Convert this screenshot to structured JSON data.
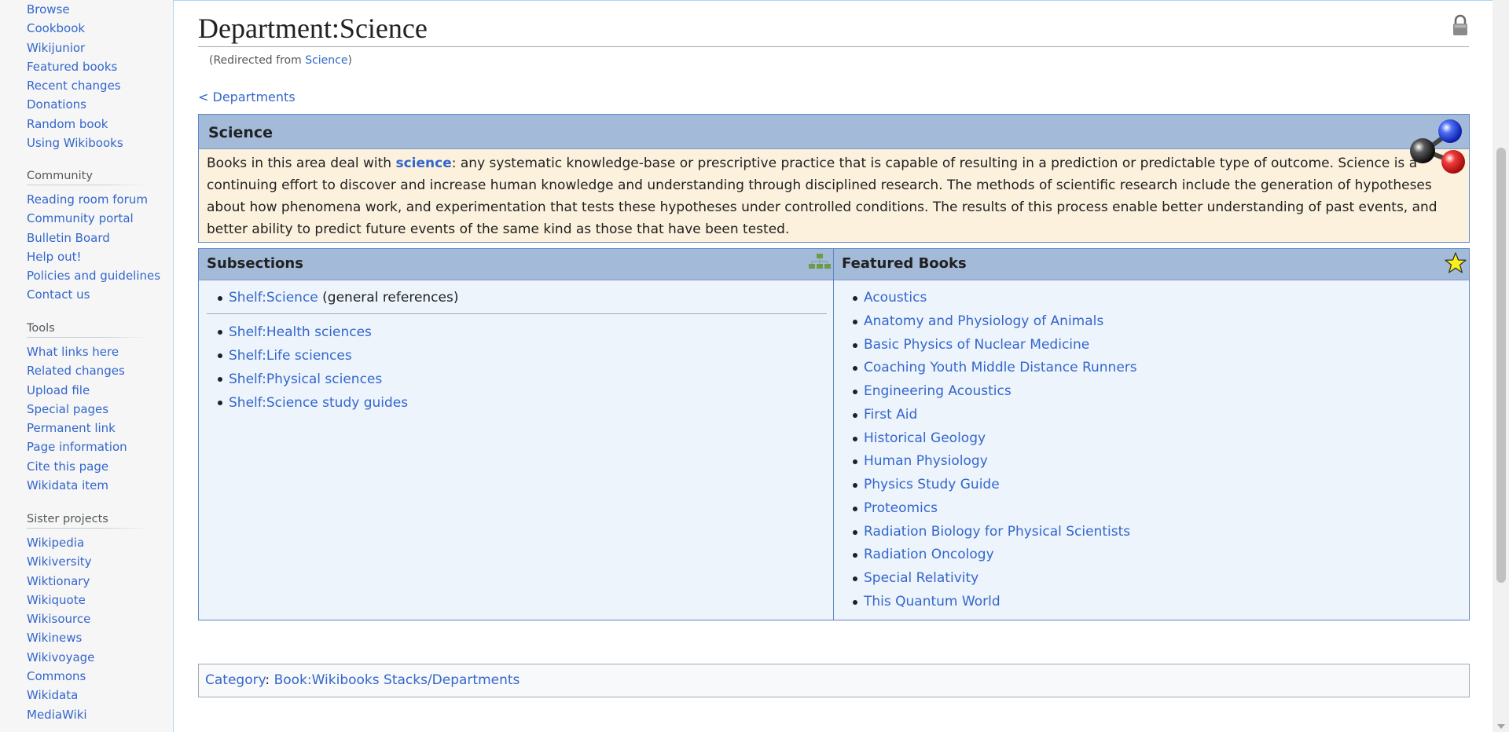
{
  "sidebar": {
    "navigation": [
      "Browse",
      "Cookbook",
      "Wikijunior",
      "Featured books",
      "Recent changes",
      "Donations",
      "Random book",
      "Using Wikibooks"
    ],
    "community": {
      "heading": "Community",
      "items": [
        "Reading room forum",
        "Community portal",
        "Bulletin Board",
        "Help out!",
        "Policies and guidelines",
        "Contact us"
      ]
    },
    "tools": {
      "heading": "Tools",
      "items": [
        "What links here",
        "Related changes",
        "Upload file",
        "Special pages",
        "Permanent link",
        "Page information",
        "Cite this page",
        "Wikidata item"
      ]
    },
    "sister": {
      "heading": "Sister projects",
      "items": [
        "Wikipedia",
        "Wikiversity",
        "Wiktionary",
        "Wikiquote",
        "Wikisource",
        "Wikinews",
        "Wikivoyage",
        "Commons",
        "Wikidata",
        "MediaWiki"
      ]
    }
  },
  "page": {
    "title": "Department:Science",
    "redirect_prefix": "(Redirected from ",
    "redirect_link": "Science",
    "redirect_suffix": ")",
    "back_link": "< Departments"
  },
  "department": {
    "heading": "Science",
    "desc_before": "Books in this area deal with ",
    "desc_link": "science",
    "desc_after": ": any systematic knowledge-base or prescriptive practice that is capable of resulting in a prediction or predictable type of outcome. Science is a continuing effort to discover and increase human knowledge and understanding through disciplined research. The methods of scientific research include the generation of hypotheses about how phenomena work, and experimentation that tests these hypotheses under controlled conditions. The results of this process enable better understanding of past events, and better ability to predict future events of the same kind as those that have been tested."
  },
  "subsections": {
    "heading": "Subsections",
    "general": {
      "link": "Shelf:Science",
      "note": " (general references)"
    },
    "items": [
      "Shelf:Health sciences",
      "Shelf:Life sciences",
      "Shelf:Physical sciences",
      "Shelf:Science study guides"
    ]
  },
  "featured": {
    "heading": "Featured Books",
    "items": [
      "Acoustics",
      "Anatomy and Physiology of Animals",
      "Basic Physics of Nuclear Medicine",
      "Coaching Youth Middle Distance Runners",
      "Engineering Acoustics",
      "First Aid",
      "Historical Geology",
      "Human Physiology",
      "Physics Study Guide",
      "Proteomics",
      "Radiation Biology for Physical Scientists",
      "Radiation Oncology",
      "Special Relativity",
      "This Quantum World"
    ]
  },
  "category": {
    "label": "Category",
    "separator": ": ",
    "link": "Book:Wikibooks Stacks/Departments"
  },
  "colors": {
    "link": "#3366cc",
    "header_blue": "#a3bad8",
    "panel_bg": "#edf4fc",
    "description_bg": "#fcf1dc",
    "border_blue": "#5b87c6"
  }
}
